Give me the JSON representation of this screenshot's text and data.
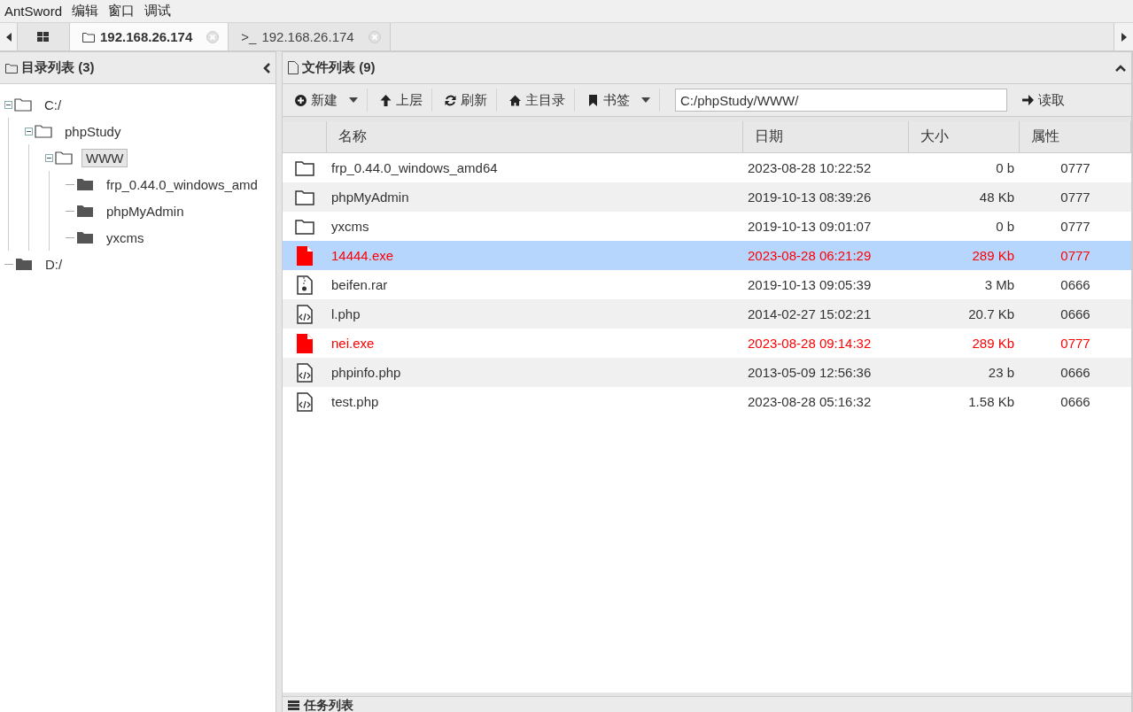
{
  "menu": [
    "AntSword",
    "编辑",
    "窗口",
    "调试"
  ],
  "tabs": [
    {
      "kind": "home",
      "selected": false
    },
    {
      "kind": "files",
      "label": "192.168.26.174",
      "selected": true
    },
    {
      "kind": "terminal",
      "prefix": ">_",
      "label": "192.168.26.174",
      "selected": false
    }
  ],
  "dir_panel": {
    "title": "目录列表 (3)",
    "tree": [
      {
        "label": "C:/",
        "expanded": true,
        "selected": false,
        "children": [
          {
            "label": "phpStudy",
            "expanded": true,
            "selected": false,
            "children": [
              {
                "label": "WWW",
                "expanded": true,
                "selected": true,
                "children": [
                  {
                    "label": "frp_0.44.0_windows_amd",
                    "expanded": false,
                    "selected": false
                  },
                  {
                    "label": "phpMyAdmin",
                    "expanded": false,
                    "selected": false
                  },
                  {
                    "label": "yxcms",
                    "expanded": false,
                    "selected": false
                  }
                ]
              }
            ]
          }
        ]
      },
      {
        "label": "D:/",
        "expanded": false,
        "selected": false
      }
    ]
  },
  "file_panel": {
    "title": "文件列表 (9)",
    "toolbar": [
      {
        "kind": "plus",
        "label": "新建",
        "dropdown": true
      },
      {
        "kind": "up",
        "label": "上层",
        "dropdown": false
      },
      {
        "kind": "refresh",
        "label": "刷新",
        "dropdown": false
      },
      {
        "kind": "home",
        "label": "主目录",
        "dropdown": false
      },
      {
        "kind": "bookmark",
        "label": "书签",
        "dropdown": true
      }
    ],
    "path": "C:/phpStudy/WWW/",
    "read_button": "读取",
    "columns": [
      "名称",
      "日期",
      "大小",
      "属性"
    ],
    "rows": [
      {
        "kind": "folder",
        "name": "frp_0.44.0_windows_amd64",
        "date": "2023-08-28 10:22:52",
        "size": "0 b",
        "attr": "0777",
        "selected": false
      },
      {
        "kind": "folder",
        "name": "phpMyAdmin",
        "date": "2019-10-13 08:39:26",
        "size": "48 Kb",
        "attr": "0777",
        "selected": false
      },
      {
        "kind": "folder",
        "name": "yxcms",
        "date": "2019-10-13 09:01:07",
        "size": "0 b",
        "attr": "0777",
        "selected": false
      },
      {
        "kind": "exe",
        "name": "14444.exe",
        "date": "2023-08-28 06:21:29",
        "size": "289 Kb",
        "attr": "0777",
        "selected": true
      },
      {
        "kind": "archive",
        "name": "beifen.rar",
        "date": "2019-10-13 09:05:39",
        "size": "3 Mb",
        "attr": "0666",
        "selected": false
      },
      {
        "kind": "code",
        "name": "l.php",
        "date": "2014-02-27 15:02:21",
        "size": "20.7 Kb",
        "attr": "0666",
        "selected": false
      },
      {
        "kind": "exe",
        "name": "nei.exe",
        "date": "2023-08-28 09:14:32",
        "size": "289 Kb",
        "attr": "0777",
        "selected": false
      },
      {
        "kind": "code",
        "name": "phpinfo.php",
        "date": "2013-05-09 12:56:36",
        "size": "23 b",
        "attr": "0666",
        "selected": false
      },
      {
        "kind": "code",
        "name": "test.php",
        "date": "2023-08-28 05:16:32",
        "size": "1.58 Kb",
        "attr": "0666",
        "selected": false
      }
    ]
  },
  "task_panel": {
    "title": "任务列表"
  }
}
